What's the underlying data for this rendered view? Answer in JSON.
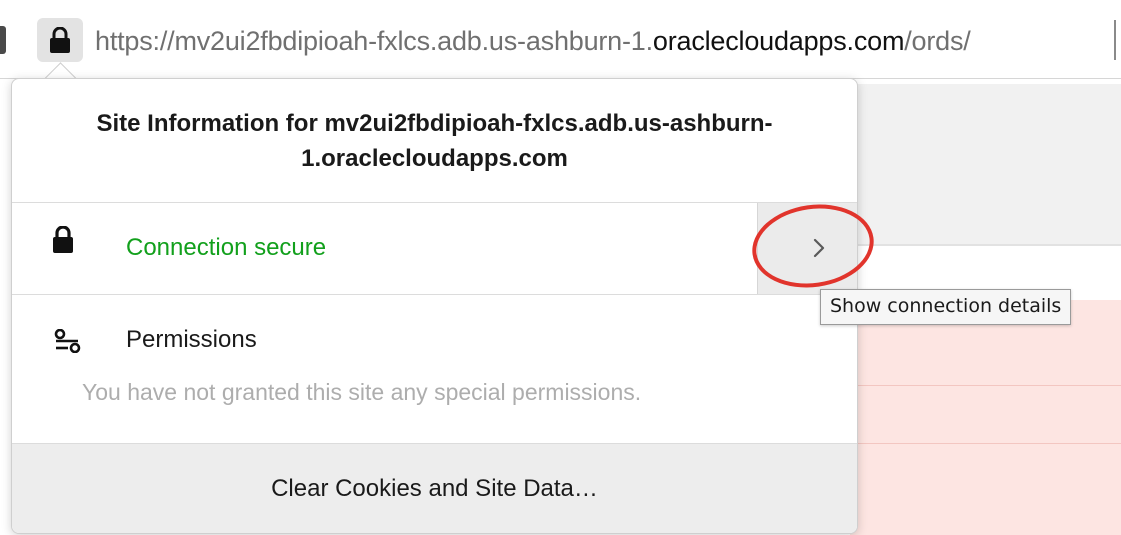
{
  "urlbar": {
    "url_prefix": "https://mv2ui2fbdipioah-fxlcs.adb.us-ashburn-1.",
    "url_domain": "oraclecloudapps.com",
    "url_suffix": "/ords/",
    "lock_icon": "lock-icon"
  },
  "popup": {
    "title": "Site Information for mv2ui2fbdipioah-fxlcs.adb.us-ashburn-1.oraclecloudapps.com",
    "security": {
      "label": "Connection secure",
      "icon": "lock-icon",
      "color": "#12a01c",
      "expand_icon": "chevron-right-icon"
    },
    "permissions": {
      "label": "Permissions",
      "icon": "permissions-icon",
      "empty_text": "You have not granted this site any special permissions."
    },
    "footer": {
      "clear_label": "Clear Cookies and Site Data…"
    }
  },
  "tooltip": {
    "text": "Show connection details"
  },
  "colors": {
    "secure_green": "#12a01c",
    "annotation_red": "#e1342c",
    "page_pink": "#fde5e2"
  }
}
